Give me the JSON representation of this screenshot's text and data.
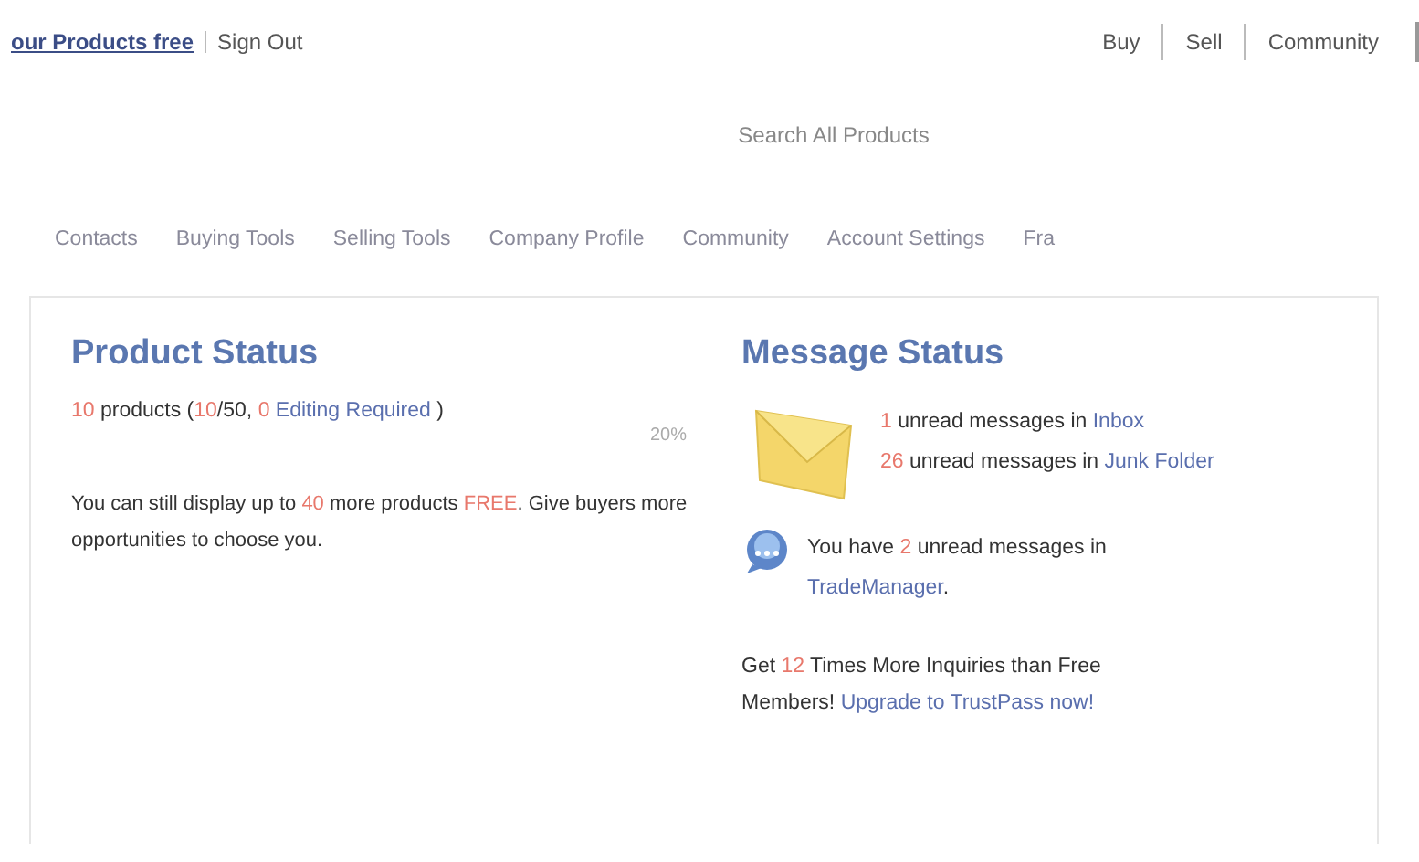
{
  "header": {
    "account_links": [
      {
        "text": "our Products free",
        "kind": "link"
      },
      {
        "text": "Sign Out",
        "kind": "plain"
      }
    ],
    "top_nav": [
      "Buy",
      "Sell",
      "Community"
    ]
  },
  "search": {
    "label": "Search All Products"
  },
  "tabs": [
    "Contacts",
    "Buying Tools",
    "Selling Tools",
    "Company Profile",
    "Community",
    "Account Settings",
    "Fra"
  ],
  "product_status": {
    "title": "Product Status",
    "summary": [
      {
        "text": "10",
        "kind": "number"
      },
      {
        "text": " products (",
        "kind": "text"
      },
      {
        "text": "10",
        "kind": "number"
      },
      {
        "text": "/50, ",
        "kind": "text"
      },
      {
        "text": "0 ",
        "kind": "number"
      },
      {
        "text": "Editing Required",
        "kind": "link"
      },
      {
        "text": " )",
        "kind": "text"
      }
    ],
    "percent": "20%",
    "note": [
      {
        "text": "You can still display up to ",
        "kind": "text"
      },
      {
        "text": "40",
        "kind": "number"
      },
      {
        "text": " more products ",
        "kind": "text"
      },
      {
        "text": "FREE",
        "kind": "number"
      },
      {
        "text": ". Give buyers more opportunities to choose you.",
        "kind": "text"
      }
    ]
  },
  "message_status": {
    "title": "Message Status",
    "mail_lines": [
      [
        {
          "text": "1",
          "kind": "number"
        },
        {
          "text": " unread messages in ",
          "kind": "text"
        },
        {
          "text": "Inbox",
          "kind": "link"
        }
      ],
      [
        {
          "text": "26",
          "kind": "number"
        },
        {
          "text": " unread messages in ",
          "kind": "text"
        },
        {
          "text": "Junk Folder",
          "kind": "link"
        }
      ]
    ],
    "trade_manager": [
      {
        "text": "You have ",
        "kind": "text"
      },
      {
        "text": "2",
        "kind": "number"
      },
      {
        "text": " unread messages in ",
        "kind": "text"
      },
      {
        "text": "TradeManager",
        "kind": "link"
      },
      {
        "text": ".",
        "kind": "text"
      }
    ],
    "promo": [
      {
        "text": "Get ",
        "kind": "text"
      },
      {
        "text": "12",
        "kind": "number"
      },
      {
        "text": " Times More Inquiries than Free Members! ",
        "kind": "text"
      },
      {
        "text": "Upgrade to TrustPass now!",
        "kind": "link"
      }
    ]
  }
}
